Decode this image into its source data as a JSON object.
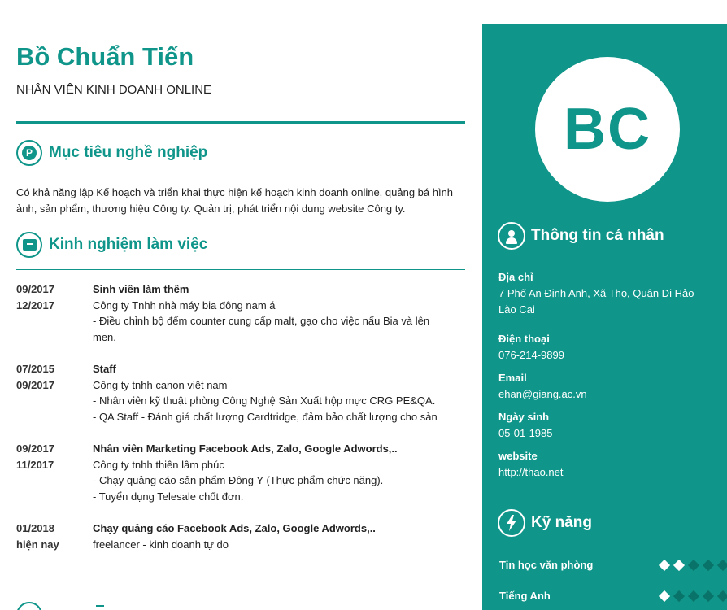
{
  "header": {
    "name": "Bồ Chuẩn Tiến",
    "role": "NHÂN VIÊN KINH DOANH ONLINE"
  },
  "sections": {
    "objective_title": "Mục tiêu nghề nghiệp",
    "objective_text": "Có khả năng lập Kế hoạch và triển khai thực hiện kế hoạch kinh doanh online, quảng bá hình ảnh, sản phẩm, thương hiệu Công ty. Quản trị, phát triển nội dung website Công ty.",
    "experience_title": "Kinh nghiệm làm việc"
  },
  "jobs": [
    {
      "start": "09/2017",
      "end": "12/2017",
      "title": "Sinh viên làm thêm",
      "lines": [
        "Công ty Tnhh nhà máy bia đông nam á",
        "- Điều chỉnh bộ đếm counter cung cấp malt, gạo cho việc nấu Bia và lên",
        "men."
      ]
    },
    {
      "start": "07/2015",
      "end": "09/2017",
      "title": "Staff",
      "lines": [
        "Công ty tnhh canon việt nam",
        "- Nhân viên kỹ thuật phòng Công Nghệ Sản Xuất hộp mực CRG PE&QA.",
        "- QA Staff - Đánh giá chất lượng Cardtridge, đảm bảo chất lượng cho sản"
      ]
    },
    {
      "start": "09/2017",
      "end": "11/2017",
      "title": "Nhân viên Marketing Facebook Ads, Zalo, Google Adwords,..",
      "lines": [
        "Công ty tnhh thiên lâm phúc",
        "- Chạy quảng cáo sản phẩm Đông Y (Thực phẩm chức năng).",
        "- Tuyển dụng Telesale chốt đơn."
      ]
    },
    {
      "start": "01/2018",
      "end": "hiện nay",
      "title": "Chạy quảng cáo Facebook Ads, Zalo, Google Adwords,..",
      "lines": [
        "freelancer - kinh doanh tự do"
      ]
    }
  ],
  "sidebar": {
    "initials": "BC",
    "personal_title": "Thông tin cá nhân",
    "address_label": "Địa chỉ",
    "address_line1": "7 Phố An Định Anh, Xã Thọ, Quận Di Hảo",
    "address_line2": "Lào Cai",
    "phone_label": "Điện thoại",
    "phone": "076-214-9899",
    "email_label": "Email",
    "email": "ehan@giang.ac.vn",
    "dob_label": "Ngày sinh",
    "dob": "05-01-1985",
    "website_label": "website",
    "website": "http://thao.net",
    "skills_title": "Kỹ năng",
    "skills": [
      {
        "name": "Tin học văn phòng",
        "level": 2,
        "max": 5
      },
      {
        "name": "Tiếng Anh",
        "level": 1,
        "max": 5
      }
    ]
  },
  "colors": {
    "accent": "#0f9589",
    "accent_dark": "#0a7369",
    "text": "#222222"
  },
  "icons": {
    "objective": "pinterest-icon",
    "experience": "archive-box-icon",
    "personal": "user-icon",
    "skills": "lightning-bolt-icon"
  }
}
